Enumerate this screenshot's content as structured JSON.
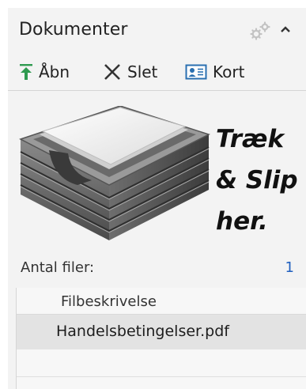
{
  "panel": {
    "title": "Dokumenter",
    "icons": {
      "settings": "gears-icon",
      "collapse": "chevron-up-icon"
    }
  },
  "toolbar": {
    "open_label": "Åbn",
    "delete_label": "Slet",
    "card_label": "Kort",
    "icons": {
      "open": "upload-arrow-icon",
      "delete": "x-icon",
      "card": "contact-card-icon"
    },
    "accent": "#2e9a4f"
  },
  "dropzone": {
    "text": "Træk\n& Slip\nher.",
    "icon": "document-tray-icon"
  },
  "file_count": {
    "label": "Antal filer:",
    "value": "1",
    "value_color": "#1f5fbf"
  },
  "file_list": {
    "column_header": "Filbeskrivelse",
    "rows": [
      {
        "name": "Handelsbetingelser.pdf"
      }
    ]
  }
}
